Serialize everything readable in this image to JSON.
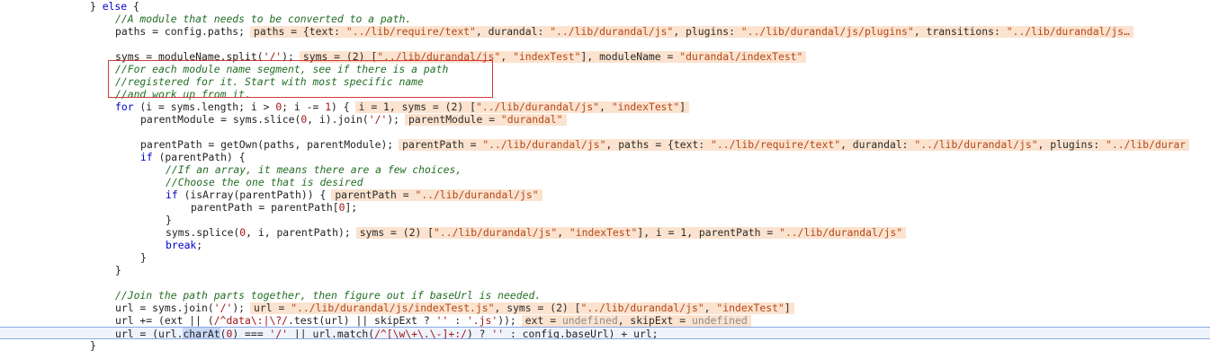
{
  "editor": {
    "lines": [
      {
        "indent": 100,
        "tokens": [
          {
            "c": "plain",
            "t": "} "
          },
          {
            "c": "kw",
            "t": "else"
          },
          {
            "c": "plain",
            "t": " {"
          }
        ]
      },
      {
        "indent": 128,
        "tokens": [
          {
            "c": "cm",
            "t": "//A module that needs to be converted to a path."
          }
        ]
      },
      {
        "indent": 128,
        "tokens": [
          {
            "c": "plain",
            "t": "paths = config.paths;"
          }
        ],
        "hint": [
          {
            "c": "p",
            "t": "paths = {text: "
          },
          {
            "c": "s",
            "t": "\"../lib/require/text\""
          },
          {
            "c": "p",
            "t": ", durandal: "
          },
          {
            "c": "s",
            "t": "\"../lib/durandal/js\""
          },
          {
            "c": "p",
            "t": ", plugins: "
          },
          {
            "c": "s",
            "t": "\"../lib/durandal/js/plugins\""
          },
          {
            "c": "p",
            "t": ", transitions: "
          },
          {
            "c": "s",
            "t": "\"../lib/durandal/js…"
          }
        ]
      },
      {
        "indent": 128,
        "tokens": []
      },
      {
        "indent": 128,
        "tokens": [
          {
            "c": "plain",
            "t": "syms = moduleName.split("
          },
          {
            "c": "str",
            "t": "'/'"
          },
          {
            "c": "plain",
            "t": ");"
          }
        ],
        "hint": [
          {
            "c": "p",
            "t": "syms = (2) ["
          },
          {
            "c": "s",
            "t": "\"../lib/durandal/js\""
          },
          {
            "c": "p",
            "t": ", "
          },
          {
            "c": "s",
            "t": "\"indexTest\""
          },
          {
            "c": "p",
            "t": "], moduleName = "
          },
          {
            "c": "s",
            "t": "\"durandal/indexTest\""
          }
        ]
      },
      {
        "indent": 128,
        "tokens": [
          {
            "c": "cm",
            "t": "//For each module name segment, see if there is a path"
          }
        ]
      },
      {
        "indent": 128,
        "tokens": [
          {
            "c": "cm",
            "t": "//registered for it. Start with most specific name"
          }
        ]
      },
      {
        "indent": 128,
        "tokens": [
          {
            "c": "cm",
            "t": "//and work up from it."
          }
        ]
      },
      {
        "indent": 128,
        "tokens": [
          {
            "c": "kw",
            "t": "for"
          },
          {
            "c": "plain",
            "t": " (i = syms.length; i > "
          },
          {
            "c": "str",
            "t": "0"
          },
          {
            "c": "plain",
            "t": "; i -= "
          },
          {
            "c": "str",
            "t": "1"
          },
          {
            "c": "plain",
            "t": ") {"
          }
        ],
        "hint": [
          {
            "c": "p",
            "t": "i = 1, syms = (2) ["
          },
          {
            "c": "s",
            "t": "\"../lib/durandal/js\""
          },
          {
            "c": "p",
            "t": ", "
          },
          {
            "c": "s",
            "t": "\"indexTest\""
          },
          {
            "c": "p",
            "t": "]"
          }
        ]
      },
      {
        "indent": 156,
        "tokens": [
          {
            "c": "plain",
            "t": "parentModule = syms.slice("
          },
          {
            "c": "str",
            "t": "0"
          },
          {
            "c": "plain",
            "t": ", i).join("
          },
          {
            "c": "str",
            "t": "'/'"
          },
          {
            "c": "plain",
            "t": ");"
          }
        ],
        "hint": [
          {
            "c": "p",
            "t": "parentModule = "
          },
          {
            "c": "s",
            "t": "\"durandal\""
          }
        ]
      },
      {
        "indent": 156,
        "tokens": []
      },
      {
        "indent": 156,
        "tokens": [
          {
            "c": "plain",
            "t": "parentPath = getOwn(paths, parentModule);"
          }
        ],
        "hint": [
          {
            "c": "p",
            "t": "parentPath = "
          },
          {
            "c": "s",
            "t": "\"../lib/durandal/js\""
          },
          {
            "c": "p",
            "t": ", paths = {text: "
          },
          {
            "c": "s",
            "t": "\"../lib/require/text\""
          },
          {
            "c": "p",
            "t": ", durandal: "
          },
          {
            "c": "s",
            "t": "\"../lib/durandal/js\""
          },
          {
            "c": "p",
            "t": ", plugins: "
          },
          {
            "c": "s",
            "t": "\"../lib/durar"
          }
        ]
      },
      {
        "indent": 156,
        "tokens": [
          {
            "c": "kw",
            "t": "if"
          },
          {
            "c": "plain",
            "t": " (parentPath) {"
          }
        ]
      },
      {
        "indent": 184,
        "tokens": [
          {
            "c": "cm",
            "t": "//If an array, it means there are a few choices,"
          }
        ]
      },
      {
        "indent": 184,
        "tokens": [
          {
            "c": "cm",
            "t": "//Choose the one that is desired"
          }
        ]
      },
      {
        "indent": 184,
        "tokens": [
          {
            "c": "kw",
            "t": "if"
          },
          {
            "c": "plain",
            "t": " (isArray(parentPath)) {"
          }
        ],
        "hint": [
          {
            "c": "p",
            "t": "parentPath = "
          },
          {
            "c": "s",
            "t": "\"../lib/durandal/js\""
          }
        ]
      },
      {
        "indent": 212,
        "tokens": [
          {
            "c": "plain",
            "t": "parentPath = parentPath["
          },
          {
            "c": "str",
            "t": "0"
          },
          {
            "c": "plain",
            "t": "];"
          }
        ]
      },
      {
        "indent": 184,
        "tokens": [
          {
            "c": "plain",
            "t": "}"
          }
        ]
      },
      {
        "indent": 184,
        "tokens": [
          {
            "c": "plain",
            "t": "syms.splice("
          },
          {
            "c": "str",
            "t": "0"
          },
          {
            "c": "plain",
            "t": ", i, parentPath);"
          }
        ],
        "hint": [
          {
            "c": "p",
            "t": "syms = (2) ["
          },
          {
            "c": "s",
            "t": "\"../lib/durandal/js\""
          },
          {
            "c": "p",
            "t": ", "
          },
          {
            "c": "s",
            "t": "\"indexTest\""
          },
          {
            "c": "p",
            "t": "], i = 1, parentPath = "
          },
          {
            "c": "s",
            "t": "\"../lib/durandal/js\""
          }
        ]
      },
      {
        "indent": 184,
        "tokens": [
          {
            "c": "kw",
            "t": "break"
          },
          {
            "c": "plain",
            "t": ";"
          }
        ]
      },
      {
        "indent": 156,
        "tokens": [
          {
            "c": "plain",
            "t": "}"
          }
        ]
      },
      {
        "indent": 128,
        "tokens": [
          {
            "c": "plain",
            "t": "}"
          }
        ]
      },
      {
        "indent": 128,
        "tokens": []
      },
      {
        "indent": 128,
        "tokens": [
          {
            "c": "cm",
            "t": "//Join the path parts together, then figure out if baseUrl is needed."
          }
        ]
      },
      {
        "indent": 128,
        "tokens": [
          {
            "c": "plain",
            "t": "url = syms.join("
          },
          {
            "c": "str",
            "t": "'/'"
          },
          {
            "c": "plain",
            "t": ");"
          }
        ],
        "hint": [
          {
            "c": "p",
            "t": "url = "
          },
          {
            "c": "s",
            "t": "\"../lib/durandal/js/indexTest.js\""
          },
          {
            "c": "p",
            "t": ", syms = (2) ["
          },
          {
            "c": "s",
            "t": "\"../lib/durandal/js\""
          },
          {
            "c": "p",
            "t": ", "
          },
          {
            "c": "s",
            "t": "\"indexTest\""
          },
          {
            "c": "p",
            "t": "]"
          }
        ]
      },
      {
        "indent": 128,
        "tokens": [
          {
            "c": "plain",
            "t": "url += (ext || ("
          },
          {
            "c": "str",
            "t": "/^data\\:|\\?/"
          },
          {
            "c": "plain",
            "t": ".test(url) || skipExt ? "
          },
          {
            "c": "str",
            "t": "''"
          },
          {
            "c": "plain",
            "t": " : "
          },
          {
            "c": "str",
            "t": "'.js'"
          },
          {
            "c": "plain",
            "t": "));"
          }
        ],
        "hint": [
          {
            "c": "p",
            "t": "ext = "
          },
          {
            "c": "u",
            "t": "undefined"
          },
          {
            "c": "p",
            "t": ", skipExt = "
          },
          {
            "c": "u",
            "t": "undefined"
          }
        ]
      },
      {
        "indent": 128,
        "current": true,
        "tokens": [
          {
            "c": "plain",
            "t": "url = (url."
          },
          {
            "c": "sel",
            "t": "charAt"
          },
          {
            "c": "plain",
            "t": "("
          },
          {
            "c": "str",
            "t": "0"
          },
          {
            "c": "plain",
            "t": ") === "
          },
          {
            "c": "str",
            "t": "'/'"
          },
          {
            "c": "plain",
            "t": " || url.match("
          },
          {
            "c": "str",
            "t": "/^[\\w\\+\\.\\-]+:/"
          },
          {
            "c": "plain",
            "t": ") ? "
          },
          {
            "c": "str",
            "t": "''"
          },
          {
            "c": "plain",
            "t": " : config.baseUrl) + url;"
          }
        ]
      },
      {
        "indent": 100,
        "tokens": [
          {
            "c": "plain",
            "t": "}"
          }
        ]
      }
    ]
  }
}
